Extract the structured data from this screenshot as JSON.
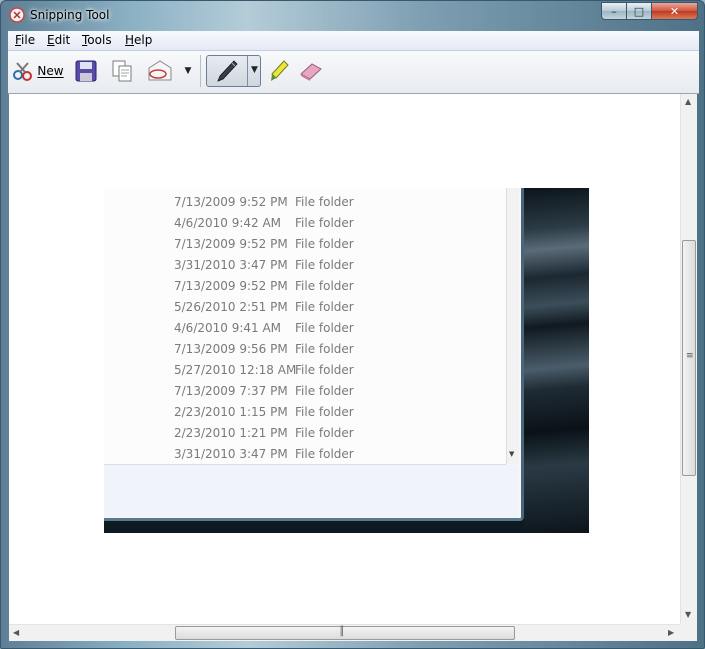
{
  "window": {
    "title": "Snipping Tool"
  },
  "menu": [
    "File",
    "Edit",
    "Tools",
    "Help"
  ],
  "toolbar": {
    "new_label": "New",
    "icons": [
      "scissors-icon",
      "save-icon",
      "copy-icon",
      "send-snip-icon",
      "dropdown-arrow-icon",
      "pen-icon",
      "highlighter-icon",
      "eraser-icon"
    ]
  },
  "snip": {
    "rows": [
      {
        "date": "7/13/2009 9:52 PM",
        "type": "File folder"
      },
      {
        "date": "4/6/2010 9:42 AM",
        "type": "File folder"
      },
      {
        "date": "7/13/2009 9:52 PM",
        "type": "File folder"
      },
      {
        "date": "3/31/2010 3:47 PM",
        "type": "File folder"
      },
      {
        "date": "7/13/2009 9:52 PM",
        "type": "File folder"
      },
      {
        "date": "5/26/2010 2:51 PM",
        "type": "File folder"
      },
      {
        "date": "4/6/2010 9:41 AM",
        "type": "File folder"
      },
      {
        "date": "7/13/2009 9:56 PM",
        "type": "File folder"
      },
      {
        "date": "5/27/2010 12:18 AM",
        "type": "File folder"
      },
      {
        "date": "7/13/2009 7:37 PM",
        "type": "File folder"
      },
      {
        "date": "2/23/2010 1:15 PM",
        "type": "File folder"
      },
      {
        "date": "2/23/2010 1:21 PM",
        "type": "File folder"
      },
      {
        "date": "3/31/2010 3:47 PM",
        "type": "File folder"
      }
    ]
  },
  "colors": {
    "title_glass": "#8ab0c3",
    "close_red": "#c03a20",
    "menu_bg": "#e4eaf5"
  }
}
